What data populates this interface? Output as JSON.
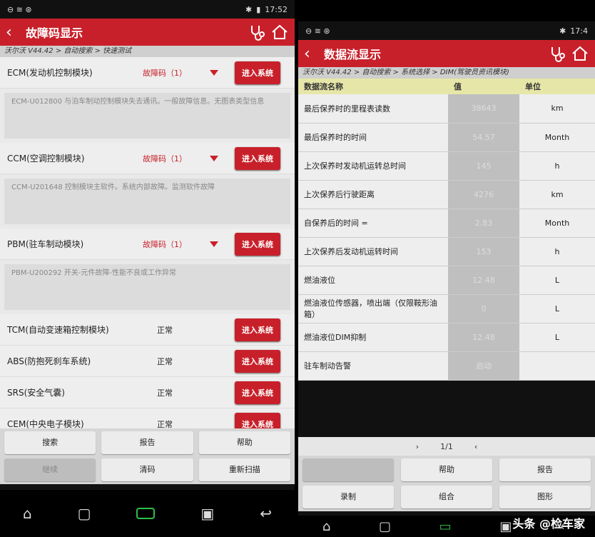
{
  "left": {
    "status_time": "17:52",
    "title": "故障码显示",
    "breadcrumb": "沃尔沃 V44.42 > 自动搜索 > 快速测试",
    "ecus": [
      {
        "name": "ECM(发动机控制模块)",
        "status": "故障码（1）",
        "has_fault": true,
        "detail": "ECM-U012800 与泊车制动控制模块失去通讯。一般故障信息。无图表类型信息"
      },
      {
        "name": "CCM(空调控制模块)",
        "status": "故障码（1）",
        "has_fault": true,
        "detail": "CCM-U201648 控制模块主软件。系统内部故障。监测软件故障"
      },
      {
        "name": "PBM(驻车制动模块)",
        "status": "故障码（1）",
        "has_fault": true,
        "detail": "PBM-U200292 开关-元件故障-性能不良或工作异常"
      },
      {
        "name": "TCM(自动变速箱控制模块)",
        "status": "正常",
        "has_fault": false
      },
      {
        "name": "ABS(防抱死刹车系统)",
        "status": "正常",
        "has_fault": false
      },
      {
        "name": "SRS(安全气囊)",
        "status": "正常",
        "has_fault": false
      },
      {
        "name": "CEM(中央电子模块)",
        "status": "正常",
        "has_fault": false
      }
    ],
    "enter_label": "进入系统",
    "buttons": [
      "搜索",
      "报告",
      "帮助",
      "继续",
      "清码",
      "重新扫描"
    ]
  },
  "right": {
    "status_time": "17:4",
    "title": "数据流显示",
    "breadcrumb": "沃尔沃 V44.42 > 自动搜索 > 系统选择 > DIM(驾驶员资讯模块)",
    "headers": [
      "数据流名称",
      "值",
      "单位"
    ],
    "rows": [
      {
        "name": "最后保养时的里程表读数",
        "value": "38643",
        "unit": "km"
      },
      {
        "name": "最后保养时的时间",
        "value": "54.57",
        "unit": "Month"
      },
      {
        "name": "上次保养时发动机运转总时间",
        "value": "145",
        "unit": "h"
      },
      {
        "name": "上次保养后行驶距离",
        "value": "4276",
        "unit": "km"
      },
      {
        "name": "自保养后的时间 =",
        "value": "2.83",
        "unit": "Month"
      },
      {
        "name": "上次保养后发动机运转时间",
        "value": "153",
        "unit": "h"
      },
      {
        "name": "燃油液位",
        "value": "12.48",
        "unit": "L"
      },
      {
        "name": "燃油液位传感器，喷出端（仅限鞍形油箱）",
        "value": "0",
        "unit": "L"
      },
      {
        "name": "燃油液位DIM抑制",
        "value": "12.48",
        "unit": "L"
      },
      {
        "name": "驻车制动告警",
        "value": "启动",
        "unit": ""
      }
    ],
    "page": "1/1",
    "buttons": [
      "",
      "帮助",
      "报告",
      "录制",
      "组合",
      "图形"
    ]
  },
  "watermark": "头条 @检车家",
  "colors": {
    "accent": "#c8202a",
    "header_yellow": "#e6e6a8"
  }
}
